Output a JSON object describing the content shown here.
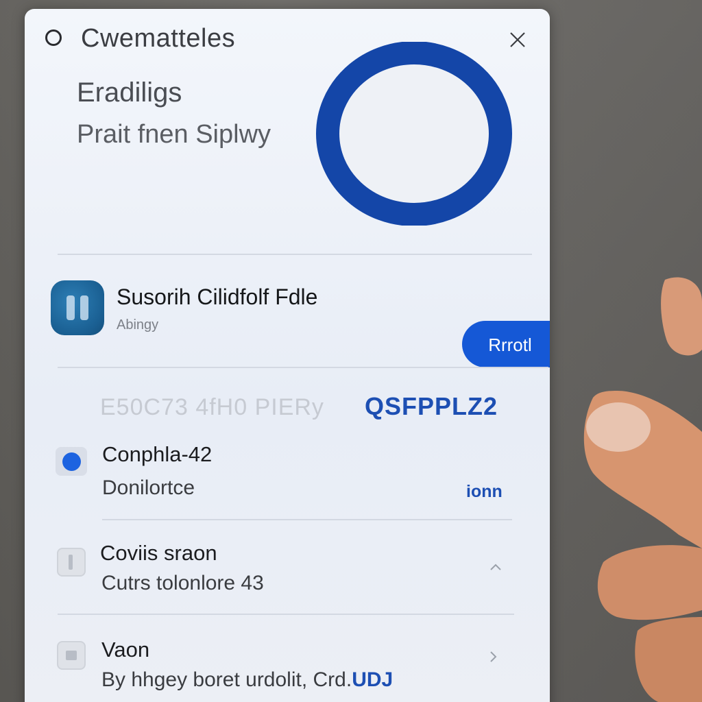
{
  "window": {
    "title": "Cwematteles"
  },
  "hero": {
    "line1": "Eradiligs",
    "line2": "Prait fnen Siplwy"
  },
  "app": {
    "name": "Susorih Cilidfolf Fdle",
    "subtitle": "Abingy",
    "button_label": "Rrrotl"
  },
  "code_row": {
    "faded": "E50C73 4fH0 PIERy",
    "accent": "QSFPPLZ2"
  },
  "rows": [
    {
      "title": "Conphla-42",
      "subtitle": "Donilortce",
      "action": "ionn",
      "icon": "radio-selected-icon"
    },
    {
      "title": "Coviis sraon",
      "subtitle": "Cutrs tolonlore 43",
      "icon": "square-icon",
      "chevron": "chevron-up-icon"
    },
    {
      "title": "Vaon",
      "subtitle_main": "By hhgey boret urdolit, Crd.",
      "subtitle_tail": "UDJ",
      "icon": "square-icon",
      "chevron": "chevron-right-icon"
    }
  ],
  "colors": {
    "accent": "#1558d6",
    "ring": "#1446a8",
    "text": "#1b1c1f"
  }
}
